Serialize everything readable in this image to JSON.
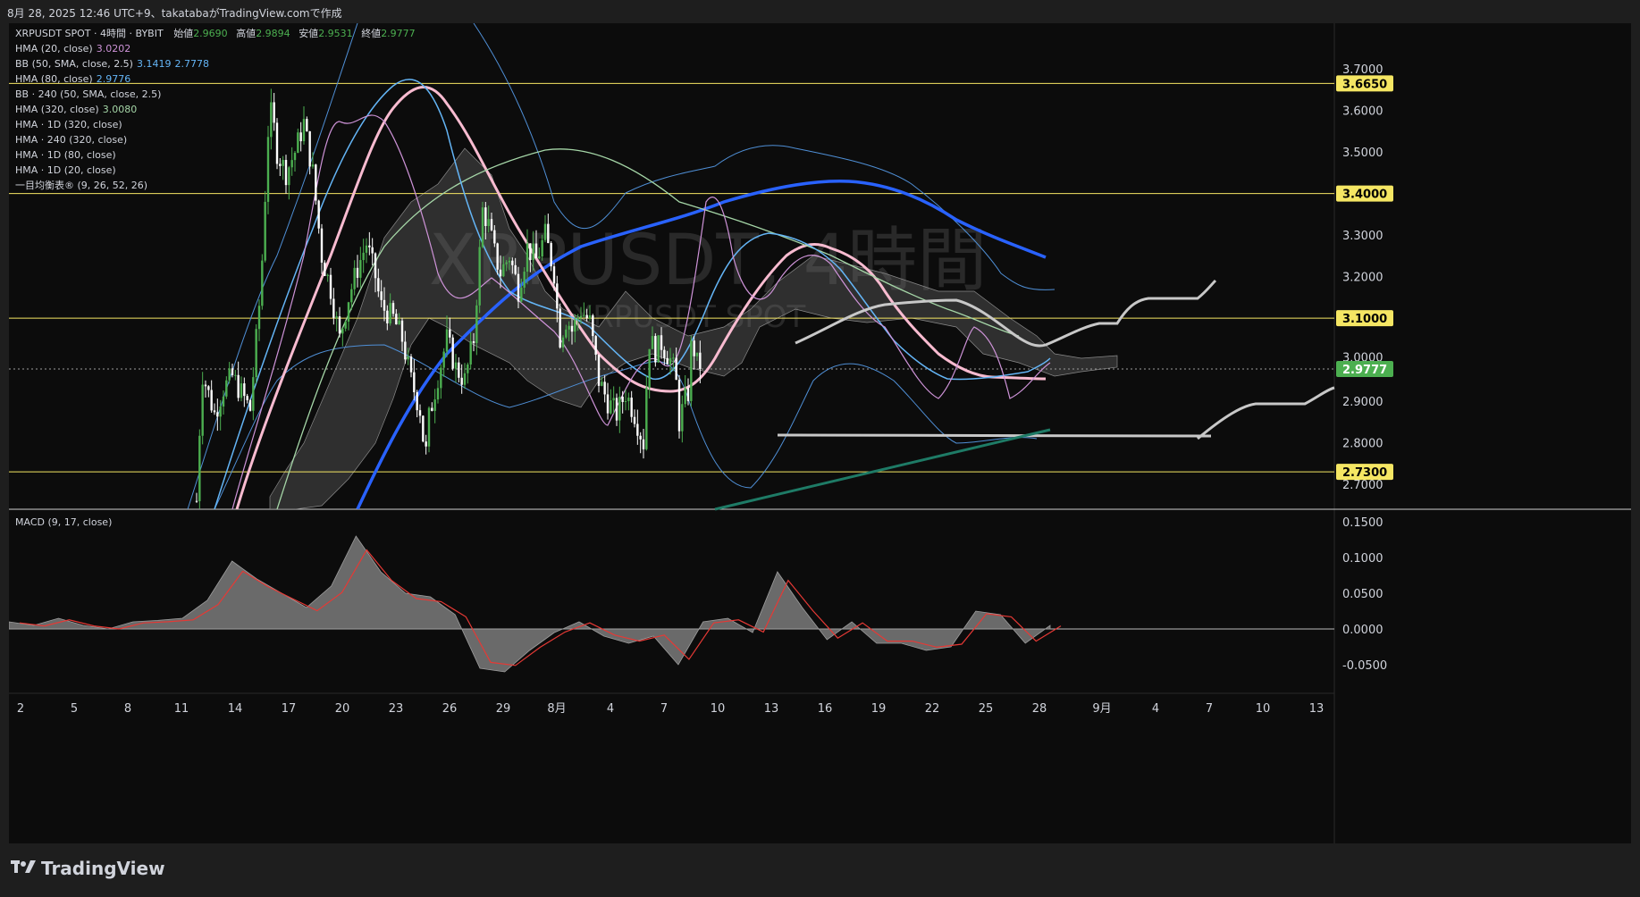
{
  "header": {
    "title": "8月 28, 2025 12:46 UTC+9、takatabaがTradingView.comで作成"
  },
  "legend": {
    "symbol": "XRPUSDT SPOT · 4時間 · BYBIT",
    "open_label": "始値",
    "open": "2.9690",
    "high_label": "高値",
    "high": "2.9894",
    "low_label": "安値",
    "low": "2.9531",
    "close_label": "終値",
    "close": "2.9777",
    "rows": [
      {
        "label": "HMA (20, close)",
        "v1": "3.0202",
        "v1_color": "#ce93d8",
        "v2": "",
        "v2_color": ""
      },
      {
        "label": "BB (50, SMA, close, 2.5)",
        "v1": "3.1419",
        "v1_color": "#64b5f6",
        "v2": "2.7778",
        "v2_color": "#64b5f6"
      },
      {
        "label": "HMA (80, close)",
        "v1": "2.9776",
        "v1_color": "#64b5f6",
        "v2": "",
        "v2_color": ""
      },
      {
        "label": "BB · 240 (50, SMA, close, 2.5)",
        "v1": "",
        "v1_color": "",
        "v2": "",
        "v2_color": ""
      },
      {
        "label": "HMA (320, close)",
        "v1": "3.0080",
        "v1_color": "#a5d6a7",
        "v2": "",
        "v2_color": ""
      },
      {
        "label": "HMA · 1D (320, close)",
        "v1": "",
        "v1_color": "",
        "v2": "",
        "v2_color": ""
      },
      {
        "label": "HMA · 240 (320, close)",
        "v1": "",
        "v1_color": "",
        "v2": "",
        "v2_color": ""
      },
      {
        "label": "HMA · 1D (80, close)",
        "v1": "",
        "v1_color": "",
        "v2": "",
        "v2_color": ""
      },
      {
        "label": "HMA · 1D (20, close)",
        "v1": "",
        "v1_color": "",
        "v2": "",
        "v2_color": ""
      },
      {
        "label": "一目均衡表® (9, 26, 52, 26)",
        "v1": "",
        "v1_color": "",
        "v2": "",
        "v2_color": ""
      }
    ],
    "macd_label": "MACD (9, 17, close)"
  },
  "watermark": {
    "line1": "XRPUSDT, 4時間",
    "line2": "XRPUSDT SPOT"
  },
  "price_axis": {
    "ticks": [
      "3.7000",
      "3.6000",
      "3.5000",
      "3.3000",
      "3.2000",
      "2.9000",
      "2.8000",
      "2.7000"
    ],
    "partial_tick": "3.0000",
    "tags": [
      {
        "label": "3.6650",
        "kind": "level"
      },
      {
        "label": "3.4000",
        "kind": "level"
      },
      {
        "label": "3.1000",
        "kind": "level"
      },
      {
        "label": "2.9777",
        "kind": "current"
      },
      {
        "label": "2.7300",
        "kind": "level"
      }
    ],
    "macd_ticks": [
      "0.1500",
      "0.1000",
      "0.0500",
      "0.0000",
      "-0.0500"
    ]
  },
  "time_axis": {
    "labels": [
      "2",
      "5",
      "8",
      "11",
      "14",
      "17",
      "20",
      "23",
      "26",
      "29",
      "8月",
      "4",
      "7",
      "10",
      "13",
      "16",
      "19",
      "22",
      "25",
      "28",
      "9月",
      "4",
      "7",
      "10",
      "13"
    ]
  },
  "colors": {
    "bull": "#4caf50",
    "bear": "#ffffff",
    "level_line": "#f5e663",
    "hma20": "#ce93d8",
    "hma80": "#64b5f6",
    "hma320": "#a5d6a7",
    "hma_1d_320": "#2962ff",
    "hma_240_320": "#f8bbd0",
    "hma_1d_80": "#c0c0c0",
    "current_price_bg": "#4caf50",
    "level_tag_bg": "#f5e663"
  },
  "chart_data": {
    "type": "candlestick",
    "ylim": [
      2.64,
      3.81
    ],
    "horizontal_levels": [
      3.665,
      3.4,
      3.1,
      2.73
    ],
    "last_price": 2.9777,
    "close_anchors": [
      {
        "d": 0.0,
        "v": 2.66
      },
      {
        "d": 0.3,
        "v": 2.97
      },
      {
        "d": 1.0,
        "v": 2.87
      },
      {
        "d": 1.5,
        "v": 2.93
      },
      {
        "d": 2.0,
        "v": 2.96
      },
      {
        "d": 3.0,
        "v": 2.88
      },
      {
        "d": 3.6,
        "v": 3.18
      },
      {
        "d": 4.0,
        "v": 3.55
      },
      {
        "d": 4.2,
        "v": 3.6
      },
      {
        "d": 4.5,
        "v": 3.5
      },
      {
        "d": 5.0,
        "v": 3.45
      },
      {
        "d": 5.5,
        "v": 3.5
      },
      {
        "d": 6.0,
        "v": 3.57
      },
      {
        "d": 6.5,
        "v": 3.45
      },
      {
        "d": 7.0,
        "v": 3.25
      },
      {
        "d": 7.5,
        "v": 3.17
      },
      {
        "d": 8.0,
        "v": 3.05
      },
      {
        "d": 8.5,
        "v": 3.15
      },
      {
        "d": 9.0,
        "v": 3.22
      },
      {
        "d": 9.5,
        "v": 3.28
      },
      {
        "d": 10.0,
        "v": 3.2
      },
      {
        "d": 10.3,
        "v": 3.13
      },
      {
        "d": 11.0,
        "v": 3.1
      },
      {
        "d": 11.5,
        "v": 3.05
      },
      {
        "d": 12.0,
        "v": 2.95
      },
      {
        "d": 12.5,
        "v": 2.88
      },
      {
        "d": 12.8,
        "v": 2.76
      },
      {
        "d": 13.0,
        "v": 2.86
      },
      {
        "d": 13.5,
        "v": 2.96
      },
      {
        "d": 14.0,
        "v": 3.05
      },
      {
        "d": 14.5,
        "v": 2.98
      },
      {
        "d": 15.0,
        "v": 2.95
      },
      {
        "d": 15.5,
        "v": 3.05
      },
      {
        "d": 16.0,
        "v": 3.36
      },
      {
        "d": 16.3,
        "v": 3.33
      },
      {
        "d": 16.7,
        "v": 3.25
      },
      {
        "d": 17.0,
        "v": 3.21
      },
      {
        "d": 17.5,
        "v": 3.25
      },
      {
        "d": 18.0,
        "v": 3.17
      },
      {
        "d": 18.5,
        "v": 3.27
      },
      {
        "d": 19.0,
        "v": 3.24
      },
      {
        "d": 19.5,
        "v": 3.3
      },
      {
        "d": 20.0,
        "v": 3.21
      },
      {
        "d": 20.3,
        "v": 3.05
      },
      {
        "d": 20.7,
        "v": 3.1
      },
      {
        "d": 21.0,
        "v": 3.07
      },
      {
        "d": 21.5,
        "v": 3.12
      },
      {
        "d": 22.0,
        "v": 3.09
      },
      {
        "d": 22.5,
        "v": 2.95
      },
      {
        "d": 23.0,
        "v": 2.9
      },
      {
        "d": 23.5,
        "v": 2.87
      },
      {
        "d": 24.0,
        "v": 2.92
      },
      {
        "d": 24.5,
        "v": 2.87
      },
      {
        "d": 25.0,
        "v": 2.8
      },
      {
        "d": 25.3,
        "v": 3.05
      },
      {
        "d": 25.7,
        "v": 3.02
      },
      {
        "d": 26.0,
        "v": 3.04
      },
      {
        "d": 26.5,
        "v": 3.0
      },
      {
        "d": 26.8,
        "v": 2.96
      },
      {
        "d": 27.0,
        "v": 2.85
      },
      {
        "d": 27.3,
        "v": 2.9
      },
      {
        "d": 27.5,
        "v": 2.92
      },
      {
        "d": 27.7,
        "v": 3.05
      },
      {
        "d": 28.0,
        "v": 2.99
      },
      {
        "d": 28.2,
        "v": 2.978
      }
    ],
    "macd": [
      {
        "d": 0,
        "v": 0.01
      },
      {
        "d": 1,
        "v": 0.005
      },
      {
        "d": 2,
        "v": 0.015
      },
      {
        "d": 3,
        "v": 0.005
      },
      {
        "d": 4,
        "v": 0.0
      },
      {
        "d": 5,
        "v": 0.01
      },
      {
        "d": 6,
        "v": 0.012
      },
      {
        "d": 7,
        "v": 0.015
      },
      {
        "d": 8,
        "v": 0.04
      },
      {
        "d": 9,
        "v": 0.095
      },
      {
        "d": 10,
        "v": 0.07
      },
      {
        "d": 11,
        "v": 0.05
      },
      {
        "d": 12,
        "v": 0.03
      },
      {
        "d": 13,
        "v": 0.06
      },
      {
        "d": 14,
        "v": 0.13
      },
      {
        "d": 15,
        "v": 0.08
      },
      {
        "d": 16,
        "v": 0.05
      },
      {
        "d": 17,
        "v": 0.045
      },
      {
        "d": 18,
        "v": 0.02
      },
      {
        "d": 19,
        "v": -0.055
      },
      {
        "d": 20,
        "v": -0.06
      },
      {
        "d": 21,
        "v": -0.03
      },
      {
        "d": 22,
        "v": -0.005
      },
      {
        "d": 23,
        "v": 0.01
      },
      {
        "d": 24,
        "v": -0.01
      },
      {
        "d": 25,
        "v": -0.02
      },
      {
        "d": 26,
        "v": -0.01
      },
      {
        "d": 27,
        "v": -0.05
      },
      {
        "d": 28,
        "v": 0.01
      },
      {
        "d": 29,
        "v": 0.015
      },
      {
        "d": 30,
        "v": -0.005
      },
      {
        "d": 31,
        "v": 0.08
      },
      {
        "d": 32,
        "v": 0.03
      },
      {
        "d": 33,
        "v": -0.015
      },
      {
        "d": 34,
        "v": 0.01
      },
      {
        "d": 35,
        "v": -0.02
      },
      {
        "d": 36,
        "v": -0.02
      },
      {
        "d": 37,
        "v": -0.03
      },
      {
        "d": 38,
        "v": -0.025
      },
      {
        "d": 39,
        "v": 0.025
      },
      {
        "d": 40,
        "v": 0.02
      },
      {
        "d": 41,
        "v": -0.02
      },
      {
        "d": 42,
        "v": 0.005
      }
    ],
    "macd_ylim": [
      -0.09,
      0.16
    ]
  }
}
